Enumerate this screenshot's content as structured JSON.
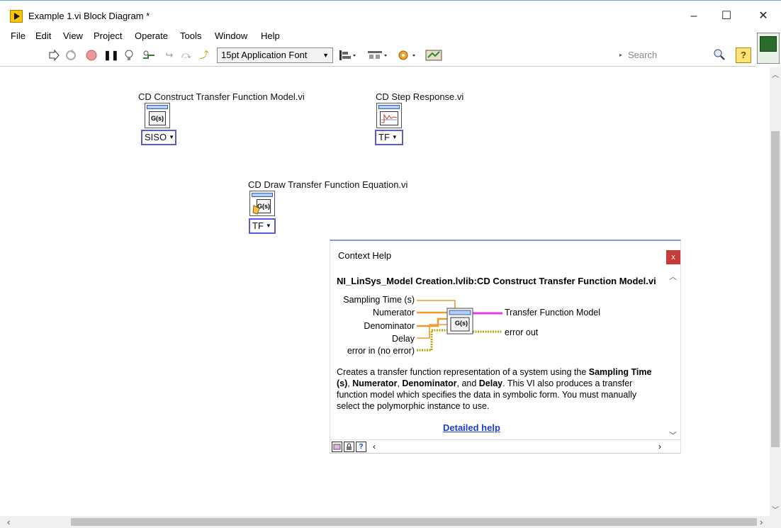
{
  "window": {
    "title": "Example 1.vi Block Diagram *",
    "minimize": "–",
    "maximize": "☐",
    "close": "✕"
  },
  "menu": [
    "File",
    "Edit",
    "View",
    "Project",
    "Operate",
    "Tools",
    "Window",
    "Help"
  ],
  "toolbar": {
    "font": "15pt Application Font",
    "search_placeholder": "Search",
    "help": "?"
  },
  "diagram": {
    "nodes": [
      {
        "label": "CD Construct Transfer Function Model.vi",
        "face": "G(s)",
        "selector": "SISO"
      },
      {
        "label": "CD Step Response.vi",
        "face": "",
        "selector": "TF"
      },
      {
        "label": "CD Draw Transfer Function Equation.vi",
        "face": "G(s)",
        "selector": "TF"
      }
    ]
  },
  "context_help": {
    "title": "Context Help",
    "close": "x",
    "path": "NI_LinSys_Model Creation.lvlib:CD Construct Transfer Function Model.vi",
    "connector_face": "G(s)",
    "inputs": [
      "Sampling Time (s)",
      "Numerator",
      "Denominator",
      "Delay",
      "error in (no error)"
    ],
    "outputs": [
      "Transfer Function Model",
      "error out"
    ],
    "description": {
      "p1": "Creates a transfer function representation of a system using the ",
      "b1": "Sampling Time (s)",
      "p2": ", ",
      "b2": "Numerator",
      "p3": ", ",
      "b3": "Denominator",
      "p4": ", and ",
      "b4": "Delay",
      "p5": ". This VI also produces a transfer function model which specifies the data in symbolic form. You must manually select the polymorphic instance to use."
    },
    "link": "Detailed help",
    "footer_help": "?"
  },
  "colors": {
    "selector_border": "#5b5bd9",
    "tf_wire": "#e83ee0",
    "numeric_wire": "#f09a2b",
    "error_wire": "#b8a20a",
    "link": "#1a3fcf"
  },
  "icons": [
    "app-icon",
    "run-arrow-icon",
    "run-continuously-icon",
    "abort-icon",
    "pause-icon",
    "highlight-execution-icon",
    "retain-wire-values-icon",
    "step-into-icon",
    "step-over-icon",
    "step-out-icon",
    "align-objects-icon",
    "distribute-objects-icon",
    "reorder-icon",
    "cleanup-diagram-icon",
    "search-icon",
    "help-icon",
    "vi-icon",
    "close-icon",
    "chevron-down-icon",
    "scroll-up-icon",
    "scroll-down-icon",
    "scroll-left-icon",
    "scroll-right-icon"
  ]
}
